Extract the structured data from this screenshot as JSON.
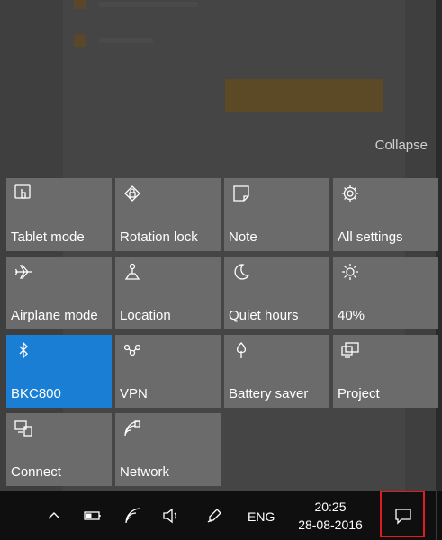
{
  "action_center": {
    "collapse_label": "Collapse",
    "tiles": [
      {
        "label": "Tablet mode",
        "icon": "tablet-mode-icon",
        "active": false
      },
      {
        "label": "Rotation lock",
        "icon": "rotation-lock-icon",
        "active": false
      },
      {
        "label": "Note",
        "icon": "note-icon",
        "active": false
      },
      {
        "label": "All settings",
        "icon": "gear-icon",
        "active": false
      },
      {
        "label": "Airplane mode",
        "icon": "airplane-icon",
        "active": false
      },
      {
        "label": "Location",
        "icon": "location-icon",
        "active": false
      },
      {
        "label": "Quiet hours",
        "icon": "moon-icon",
        "active": false
      },
      {
        "label": "40%",
        "icon": "brightness-icon",
        "active": false
      },
      {
        "label": "BKC800",
        "icon": "bluetooth-icon",
        "active": true
      },
      {
        "label": "VPN",
        "icon": "vpn-icon",
        "active": false
      },
      {
        "label": "Battery saver",
        "icon": "battery-saver-icon",
        "active": false
      },
      {
        "label": "Project",
        "icon": "project-icon",
        "active": false
      },
      {
        "label": "Connect",
        "icon": "connect-icon",
        "active": false
      },
      {
        "label": "Network",
        "icon": "network-icon",
        "active": false
      }
    ]
  },
  "taskbar": {
    "language": "ENG",
    "time": "20:25",
    "date": "28-08-2016"
  },
  "colors": {
    "accent": "#1a7fd4",
    "tile": "#6b6b6b",
    "taskbar": "#0f0f0f",
    "highlight_border": "#e01b24"
  }
}
